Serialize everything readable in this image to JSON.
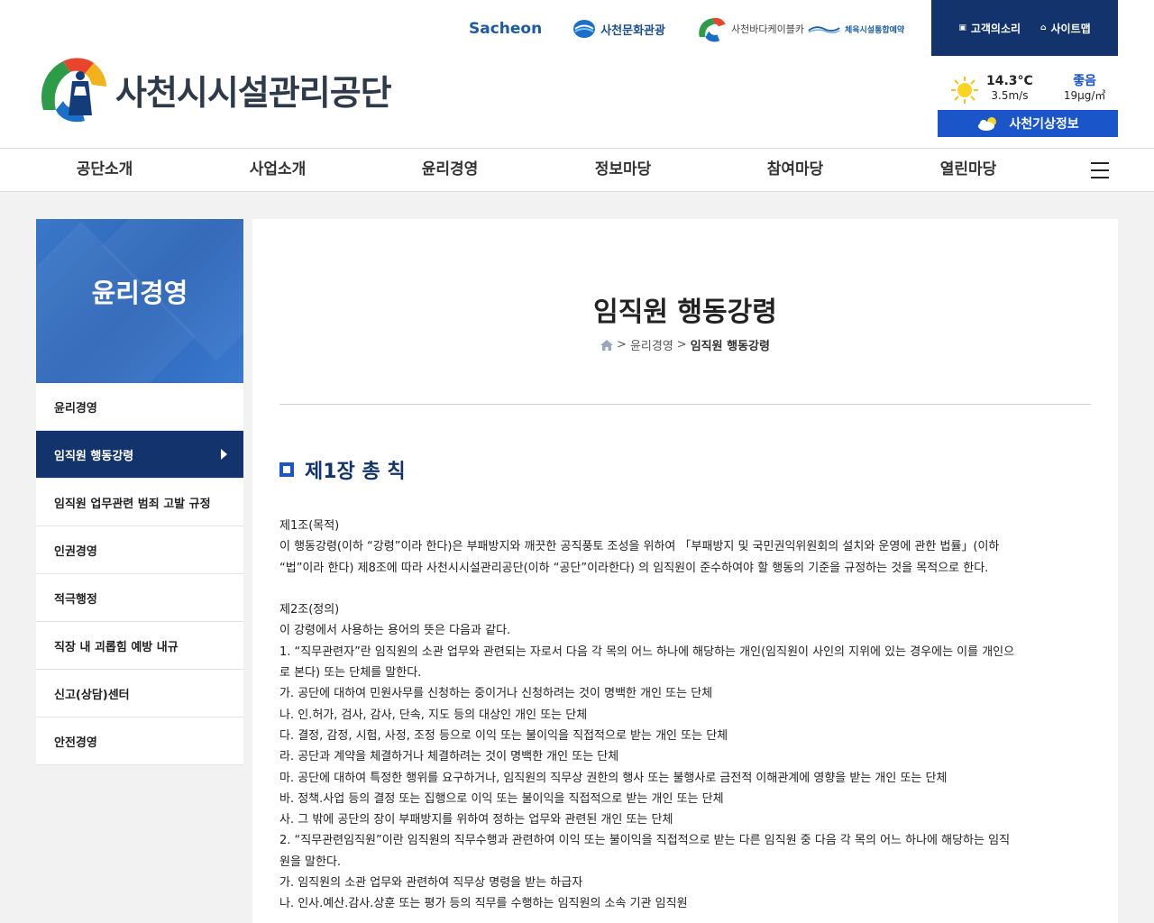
{
  "header": {
    "logo_text": "사천시시설관리공단",
    "partners": [
      {
        "label": "Sacheon"
      },
      {
        "label": "사천문화관광"
      },
      {
        "label": "사천바다케이블카"
      },
      {
        "label": "체육시설통합예약"
      }
    ],
    "top_links": [
      {
        "label": "고객의소리"
      },
      {
        "label": "사이트맵"
      }
    ],
    "weather": {
      "temp": "14.3°C",
      "wind": "3.5m/s",
      "air_quality": "좋음",
      "dust": "19µg/㎥",
      "button_label": "사천기상정보"
    }
  },
  "gnb": {
    "items": [
      "공단소개",
      "사업소개",
      "윤리경영",
      "정보마당",
      "참여마당",
      "열린마당"
    ]
  },
  "sidebar": {
    "title": "윤리경영",
    "items": [
      {
        "label": "윤리경영"
      },
      {
        "label": "임직원 행동강령"
      },
      {
        "label": "임직원 업무관련 범죄 고발 규정"
      },
      {
        "label": "인권경영"
      },
      {
        "label": "적극행정"
      },
      {
        "label": "직장 내 괴롭힘 예방 내규"
      },
      {
        "label": "신고(상담)센터"
      },
      {
        "label": "안전경영"
      }
    ]
  },
  "content": {
    "title": "임직원 행동강령",
    "breadcrumb": {
      "sep": ">",
      "parent": "윤리경영",
      "current": "임직원 행동강령"
    },
    "chapter": "제1장 총 칙",
    "lines": [
      "제1조(목적)",
      "이 행동강령(이하 “강령”이라 한다)은 부패방지와 깨끗한 공직풍토 조성을 위하여 「부패방지 및 국민권익위원회의 설치와 운영에 관한 법률」(이하",
      "“법”이라 한다) 제8조에 따라 사천시시설관리공단(이하 “공단”이라한다) 의 임직원이 준수하여야 할 행동의 기준을 규정하는 것을 목적으로 한다.",
      "",
      "제2조(정의)",
      "이 강령에서 사용하는 용어의 뜻은 다음과 같다.",
      "1. “직무관련자”란 임직원의 소관 업무와 관련되는 자로서 다음 각 목의 어느 하나에 해당하는 개인(임직원이 사인의 지위에 있는 경우에는 이를 개인으",
      "로 본다) 또는 단체를 말한다.",
      "가. 공단에 대하여 민원사무를 신청하는 중이거나 신청하려는 것이 명백한 개인 또는 단체",
      "나. 인.허가, 검사, 감사, 단속, 지도 등의 대상인 개인 또는 단체",
      "다. 결정, 감정, 시험, 사정, 조정 등으로 이익 또는 불이익을 직접적으로 받는 개인 또는 단체",
      "라. 공단과 계약을 체결하거나 체결하려는 것이 명백한 개인 또는 단체",
      "마. 공단에 대하여 특정한 행위를 요구하거나, 임직원의 직무상 권한의 행사 또는 불행사로 금전적 이해관계에 영향을 받는 개인 또는 단체",
      "바. 정책.사업 등의 결정 또는 집행으로 이익 또는 불이익을 직접적으로 받는 개인 또는 단체",
      "사. 그 밖에 공단의 장이 부패방지를 위하여 정하는 업무와 관련된 개인 또는 단체",
      "2. “직무관련임직원”이란 임직원의 직무수행과 관련하여 이익 또는 불이익을 직접적으로 받는 다른 임직원 중 다음 각 목의 어느 하나에 해당하는 임직",
      "원을 말한다.",
      "가. 임직원의 소관 업무와 관련하여 직무상 명령을 받는 하급자",
      "나. 인사.예산.감사.상훈 또는 평가 등의 직무를 수행하는 임직원의 소속 기관 임직원"
    ]
  },
  "colors": {
    "navy": "#12336b",
    "blue": "#1a55c9",
    "side_gradient": "#3a78c9"
  }
}
